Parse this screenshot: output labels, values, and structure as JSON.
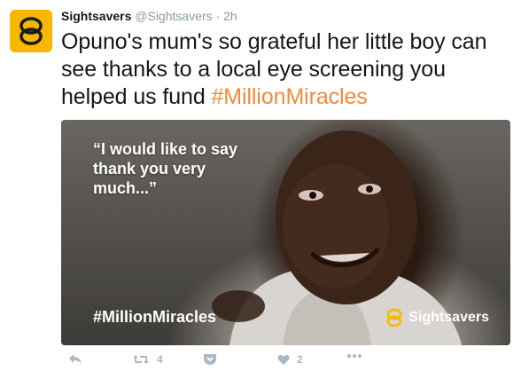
{
  "tweet": {
    "author_name": "Sightsavers",
    "author_handle": "@Sightsavers",
    "separator": "·",
    "time": "2h",
    "text_main": "Opuno's mum's so grateful her little boy can see thanks to a local eye screening you helped us fund ",
    "text_hashtag": "#MillionMiracles"
  },
  "media": {
    "quote_line": "“I would like to say thank you very much...”",
    "hashtag": "#MillionMiracles",
    "brand_name": "Sightsavers"
  },
  "actions": {
    "retweet_count": "4",
    "like_count": "2"
  },
  "colors": {
    "brand_yellow": "#f6b800",
    "hashtag_orange": "#f08a3a",
    "icon_gray": "#aab8c2"
  },
  "icons": {
    "avatar": "sightsavers-logo-icon",
    "reply": "reply-icon",
    "retweet": "retweet-icon",
    "pocket": "save-pocket-icon",
    "like": "heart-icon",
    "more": "more-dots-icon"
  }
}
